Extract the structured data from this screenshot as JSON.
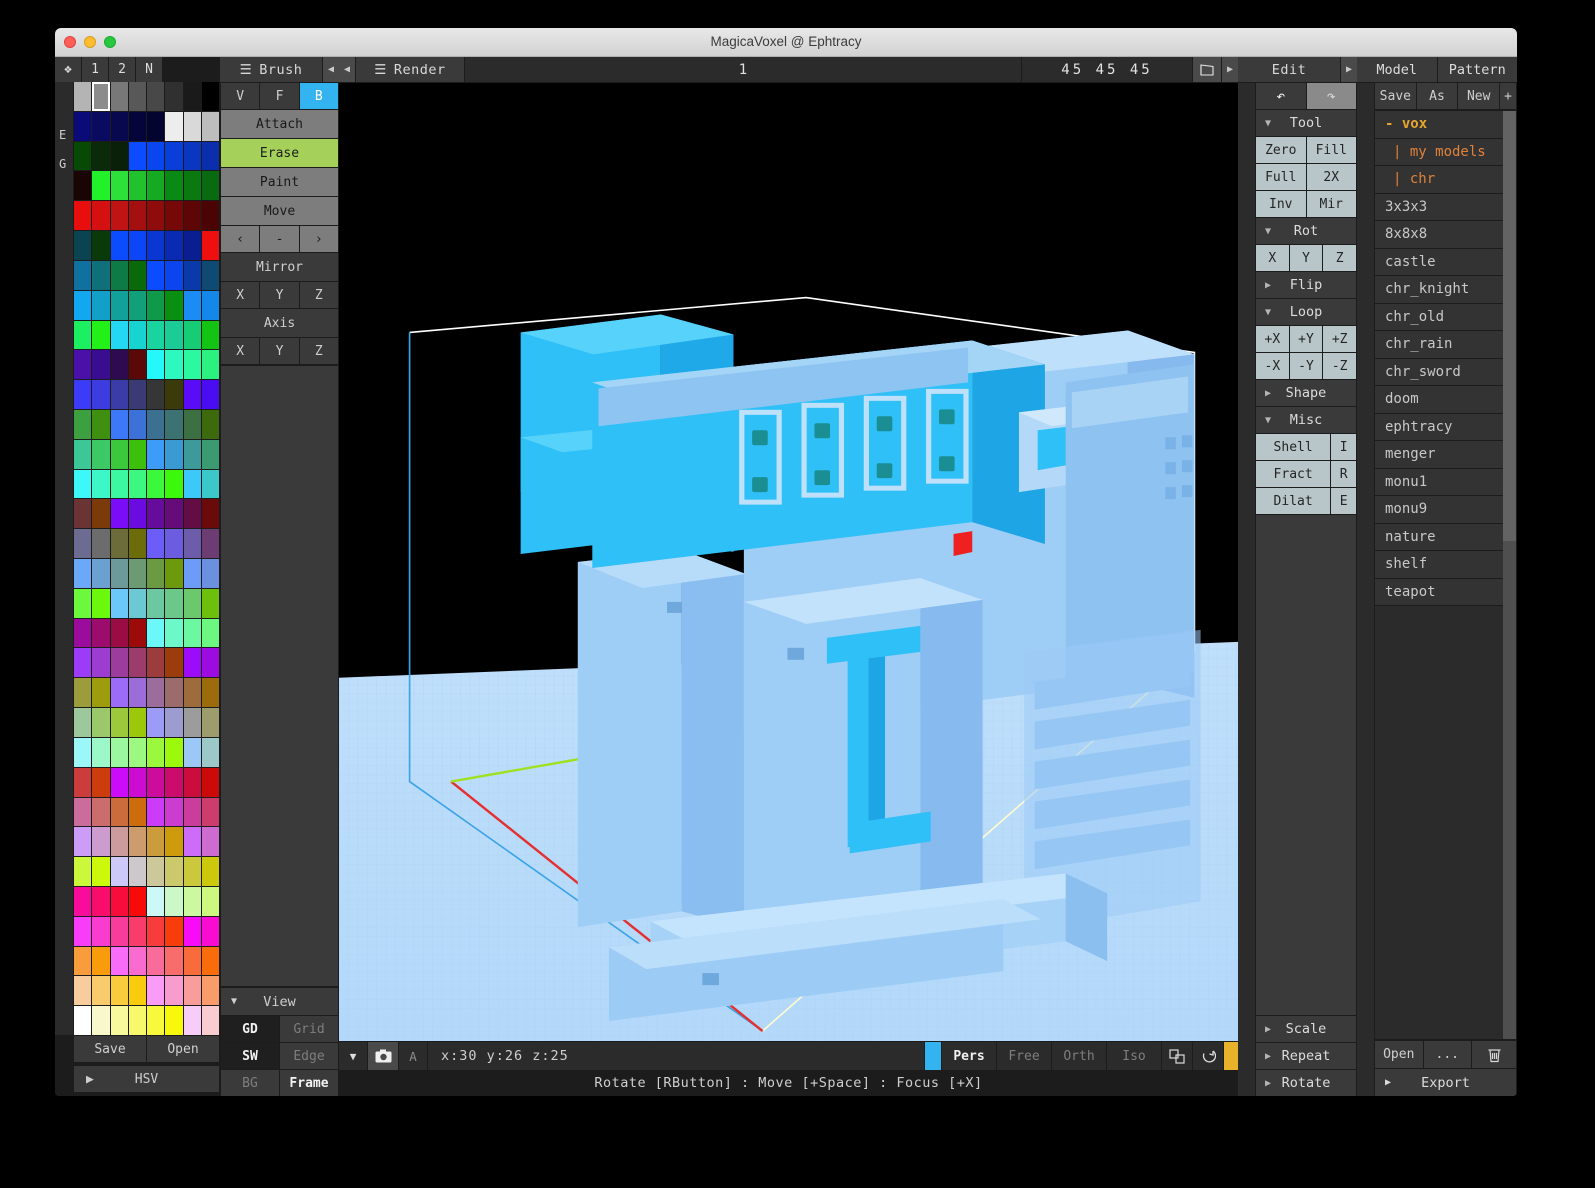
{
  "window": {
    "title": "MagicaVoxel @ Ephtracy"
  },
  "topbar": {
    "left_tabs": [
      "❖",
      "1",
      "2",
      "N"
    ],
    "brush_title": "Brush",
    "render_title": "Render",
    "model_name": "1",
    "model_size": "45 45 45",
    "size_icon": "volume-icon"
  },
  "palette": {
    "gutter_labels": [
      "E",
      "G"
    ],
    "save_label": "Save",
    "open_label": "Open",
    "hsv_label": "HSV",
    "selected_index": 1,
    "colors": [
      "#b4b4b4",
      "#8c8c8c",
      "#787878",
      "#585858",
      "#484848",
      "#303030",
      "#1a1a1a",
      "#000000",
      "#0a0a78",
      "#0a0a60",
      "#08084e",
      "#05053a",
      "#040430",
      "#ededed",
      "#d9d9d9",
      "#bdbdbd",
      "#064a06",
      "#0a2a0a",
      "#0a2008",
      "#0c4bff",
      "#0a46f0",
      "#0a3ed8",
      "#0a36c0",
      "#0a2eac",
      "#1a0505",
      "#22f02a",
      "#2ee03a",
      "#22c22e",
      "#16aa22",
      "#0a8a14",
      "#0a7a10",
      "#0a6a12",
      "#e80e0e",
      "#d41010",
      "#c01414",
      "#a41010",
      "#8e0c0c",
      "#760808",
      "#5e0606",
      "#4a0404",
      "#0a4450",
      "#0a3a0a",
      "#0c4cff",
      "#0c46f6",
      "#0a36d2",
      "#0a2ab4",
      "#0a1e92",
      "#ee1010",
      "#1070a0",
      "#10707a",
      "#0e7a46",
      "#0a6a0a",
      "#0c4cff",
      "#0c44ee",
      "#0a3aaa",
      "#0e4a72",
      "#12a8f0",
      "#12a0c8",
      "#12a09a",
      "#12a07a",
      "#0e9a4a",
      "#0a9010",
      "#1a8cf4",
      "#1488ea",
      "#1cf060",
      "#22f018",
      "#24d8f4",
      "#18d4d0",
      "#1ad4a0",
      "#1ccc96",
      "#16cc74",
      "#14c414",
      "#4a10a8",
      "#3a0c90",
      "#2e0a50",
      "#5a0808",
      "#24f8f8",
      "#2cf8c0",
      "#2cf8a0",
      "#2cf080",
      "#3c3cf8",
      "#3c3ce0",
      "#3c3ca8",
      "#3a3a74",
      "#363636",
      "#3a3a0a",
      "#5a0cf8",
      "#4a0cf0",
      "#3ca040",
      "#3f9010",
      "#3c78f8",
      "#3c72d8",
      "#3c7090",
      "#3c7272",
      "#3c7042",
      "#3c6a0c",
      "#3cc896",
      "#3cc864",
      "#3cc83c",
      "#3cc00c",
      "#3c9cf8",
      "#3c9ad2",
      "#3c9a9a",
      "#3c9a72",
      "#3cf8f8",
      "#3cf8c8",
      "#3cf8a0",
      "#3cf880",
      "#3cf83c",
      "#3cf80c",
      "#3cc8f8",
      "#3cc8c8",
      "#6a3434",
      "#7a3a0a",
      "#7a0cf8",
      "#6a0ce0",
      "#660c9a",
      "#660c7a",
      "#640c44",
      "#6a0a0a",
      "#6c6c92",
      "#6c6c6c",
      "#6c6c3a",
      "#6c6c0a",
      "#6c5cf8",
      "#6c5ce0",
      "#6c5caa",
      "#6c3c72",
      "#6ca8f8",
      "#6ca0d0",
      "#6c9a9a",
      "#6c9a72",
      "#6c9a42",
      "#6c9a0c",
      "#6c9cf8",
      "#6c90e0",
      "#6cf83c",
      "#6cf80c",
      "#6cc8f8",
      "#6cc8d2",
      "#6cc8a0",
      "#6cc888",
      "#6cc86c",
      "#6cc00c",
      "#9c0c9c",
      "#9c0c6c",
      "#9c0c44",
      "#9c0a0a",
      "#6cf8f8",
      "#6cf8c8",
      "#6cf8a0",
      "#6cf880",
      "#9c3cf8",
      "#9c3cd0",
      "#9c3c9c",
      "#9c3c6c",
      "#9c3c3c",
      "#9c3c0c",
      "#9c0cf8",
      "#9c0ce0",
      "#9c9c3c",
      "#9c9c0c",
      "#9c6cf8",
      "#9c6cd8",
      "#9c6c9c",
      "#9c6c6c",
      "#9c6c3c",
      "#9c6c0c",
      "#9cc89c",
      "#9cc86c",
      "#9cc83c",
      "#9cc80c",
      "#9c9cf8",
      "#9c9cd0",
      "#9c9c9c",
      "#9c9c6c",
      "#9cf8f8",
      "#9cf8c8",
      "#9cf8a0",
      "#9cf880",
      "#9cf83c",
      "#9cf80c",
      "#9cc8f8",
      "#9cc8c8",
      "#cc3c3c",
      "#cc3c0c",
      "#cc0cf8",
      "#cc0cd0",
      "#cc0c9c",
      "#cc0c6c",
      "#cc0c3c",
      "#cc0a0a",
      "#cc6c9c",
      "#cc6c6c",
      "#cc6c3c",
      "#cc6c0c",
      "#cc3cf8",
      "#cc3cd0",
      "#cc3c9c",
      "#cc3c6c",
      "#cc9cf8",
      "#cc9cd0",
      "#cc9c9c",
      "#cc9c6c",
      "#cc9c3c",
      "#cc9c0c",
      "#cc6cf8",
      "#cc6cd0",
      "#ccf83c",
      "#ccf80c",
      "#ccc8f8",
      "#ccc8cc",
      "#ccc89c",
      "#ccc86c",
      "#ccc83c",
      "#ccc80c",
      "#f80c9c",
      "#f80c6c",
      "#f80c3c",
      "#f80a0a",
      "#ccf8f8",
      "#ccf8c8",
      "#ccf8a0",
      "#ccf880",
      "#f83cf8",
      "#f83cd0",
      "#f83c9c",
      "#f83c6c",
      "#f83c3c",
      "#f83c0c",
      "#f80cf8",
      "#f80cd0",
      "#f89c3c",
      "#f89c0c",
      "#f86cf8",
      "#f86cd0",
      "#f86c9c",
      "#f86c6c",
      "#f86c3c",
      "#f86c0c",
      "#f8cc9c",
      "#f8cc6c",
      "#f8cc3c",
      "#f8cc0c",
      "#f89cf8",
      "#f89cd0",
      "#f89c9c",
      "#f89c6c",
      "#ffffff",
      "#f8f8cc",
      "#f8f89c",
      "#f8f86c",
      "#f8f83c",
      "#f8f80c",
      "#f8ccf8",
      "#f8ccd0"
    ]
  },
  "brush": {
    "modes": [
      "V",
      "F",
      "B"
    ],
    "mode_selected": "B",
    "actions": [
      "Attach",
      "Erase",
      "Paint",
      "Move"
    ],
    "action_selected": "Erase",
    "nav": [
      "‹",
      "-",
      "›"
    ],
    "mirror_label": "Mirror",
    "mirror_axes": [
      "X",
      "Y",
      "Z"
    ],
    "axis_label": "Axis",
    "axis_axes": [
      "X",
      "Y",
      "Z"
    ],
    "view_label": "View",
    "view_rows": [
      {
        "left": "GD",
        "left_on": true,
        "right": "Grid",
        "right_on": false
      },
      {
        "left": "SW",
        "left_on": true,
        "right": "Edge",
        "right_on": false
      },
      {
        "left": "BG",
        "left_on": false,
        "right": "Frame",
        "right_on": true
      }
    ]
  },
  "viewport": {
    "coords": "x:30  y:26  z:25",
    "camera_modes": [
      "Pers",
      "Free",
      "Orth",
      "Iso"
    ],
    "camera_selected": "Pers",
    "brush_color": "#34b3f1",
    "marker_color": "#e8b22a",
    "a_label": "A",
    "camera_icon": "camera-icon",
    "box_icon": "box-icon",
    "reset_icon": "reset-icon",
    "help_text": "Rotate [RButton] : Move [+Space] : Focus [+X]"
  },
  "edit": {
    "title": "Edit",
    "undo_icon": "undo-icon",
    "redo_icon": "redo-icon",
    "tool_label": "Tool",
    "tool_buttons": [
      "Zero",
      "Fill",
      "Full",
      "2X",
      "Inv",
      "Mir"
    ],
    "rot_label": "Rot",
    "rot_axes": [
      "X",
      "Y",
      "Z"
    ],
    "flip_label": "Flip",
    "loop_label": "Loop",
    "loop_pos": [
      "+X",
      "+Y",
      "+Z"
    ],
    "loop_neg": [
      "-X",
      "-Y",
      "-Z"
    ],
    "shape_label": "Shape",
    "misc_label": "Misc",
    "misc_rows": [
      {
        "name": "Shell",
        "key": "I"
      },
      {
        "name": "Fract",
        "key": "R"
      },
      {
        "name": "Dilat",
        "key": "E"
      }
    ],
    "footer": [
      "Scale",
      "Repeat",
      "Rotate"
    ]
  },
  "model": {
    "tabs": [
      "Model",
      "Pattern"
    ],
    "tab_selected": "Model",
    "actions": [
      "Save",
      "As",
      "New"
    ],
    "add_label": "+",
    "items": [
      {
        "label": "- vox",
        "kind": "root"
      },
      {
        "label": "|  my models",
        "kind": "folder"
      },
      {
        "label": "|  chr",
        "kind": "folder"
      },
      {
        "label": "3x3x3",
        "kind": "file"
      },
      {
        "label": "8x8x8",
        "kind": "file"
      },
      {
        "label": "castle",
        "kind": "file"
      },
      {
        "label": "chr_knight",
        "kind": "file"
      },
      {
        "label": "chr_old",
        "kind": "file"
      },
      {
        "label": "chr_rain",
        "kind": "file"
      },
      {
        "label": "chr_sword",
        "kind": "file"
      },
      {
        "label": "doom",
        "kind": "file"
      },
      {
        "label": "ephtracy",
        "kind": "file"
      },
      {
        "label": "menger",
        "kind": "file"
      },
      {
        "label": "monu1",
        "kind": "file"
      },
      {
        "label": "monu9",
        "kind": "file"
      },
      {
        "label": "nature",
        "kind": "file"
      },
      {
        "label": "shelf",
        "kind": "file"
      },
      {
        "label": "teapot",
        "kind": "file"
      }
    ],
    "footer_buttons": [
      "Open",
      "..."
    ],
    "trash_icon": "trash-icon",
    "export_label": "Export"
  }
}
